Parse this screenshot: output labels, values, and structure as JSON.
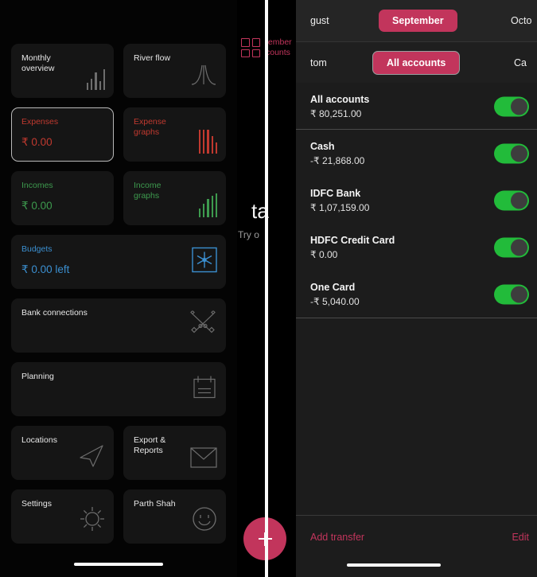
{
  "background": {
    "grid_icon": "grid-icon",
    "pink_text_line1": "tember",
    "pink_text_line2": "counts",
    "big_text": "ta",
    "sub_text": "Try o",
    "fab_icon": "plus-icon",
    "fab_color": "#c2355c"
  },
  "left_panel": {
    "cards": [
      {
        "title": "Monthly\noverview",
        "amount": "",
        "color": "#e8e8e8",
        "icon": "bar-chart-icon",
        "span": "half"
      },
      {
        "title": "River flow",
        "amount": "",
        "color": "#e8e8e8",
        "icon": "river-flow-icon",
        "span": "half"
      },
      {
        "title": "Expenses",
        "amount": "₹ 0.00",
        "color": "#c0392f",
        "icon": "",
        "span": "half",
        "selected": true
      },
      {
        "title": "Expense\ngraphs",
        "amount": "",
        "color": "#c0392f",
        "icon": "bar-chart-red-icon",
        "span": "half"
      },
      {
        "title": "Incomes",
        "amount": "₹ 0.00",
        "color": "#3d9a4e",
        "icon": "",
        "span": "half"
      },
      {
        "title": "Income\ngraphs",
        "amount": "",
        "color": "#3d9a4e",
        "icon": "bar-chart-green-icon",
        "span": "half"
      },
      {
        "title": "Budgets",
        "amount": "₹ 0.00 left",
        "color": "#3b8fd0",
        "icon": "budget-snowflake-icon",
        "span": "full"
      },
      {
        "title": "Bank connections",
        "amount": "",
        "color": "#e8e8e8",
        "icon": "crossed-keys-icon",
        "span": "full"
      },
      {
        "title": "Planning",
        "amount": "",
        "color": "#e8e8e8",
        "icon": "calendar-icon",
        "span": "full"
      },
      {
        "title": "Locations",
        "amount": "",
        "color": "#e8e8e8",
        "icon": "navigation-arrow-icon",
        "span": "half"
      },
      {
        "title": "Export &\nReports",
        "amount": "",
        "color": "#e8e8e8",
        "icon": "envelope-icon",
        "span": "half"
      },
      {
        "title": "Settings",
        "amount": "",
        "color": "#e8e8e8",
        "icon": "gear-sun-icon",
        "span": "half"
      },
      {
        "title": "Parth Shah",
        "amount": "",
        "color": "#e8e8e8",
        "icon": "smiley-face-icon",
        "span": "half"
      }
    ],
    "labels": {
      "monthly_overview": "Monthly\noverview",
      "river_flow": "River flow",
      "expenses": "Expenses",
      "expenses_amount": "₹ 0.00",
      "expense_graphs": "Expense\ngraphs",
      "incomes": "Incomes",
      "incomes_amount": "₹ 0.00",
      "income_graphs": "Income\ngraphs",
      "budgets": "Budgets",
      "budgets_amount": "₹ 0.00 left",
      "bank_connections": "Bank connections",
      "planning": "Planning",
      "locations": "Locations",
      "export_reports": "Export &\nReports",
      "settings": "Settings",
      "profile": "Parth Shah"
    }
  },
  "right_panel": {
    "month_segment": {
      "prev": "gust",
      "selected": "September",
      "next": "Octo"
    },
    "account_segment": {
      "prev": "tom",
      "selected": "All accounts",
      "next": "Ca"
    },
    "accounts": [
      {
        "name": "All accounts",
        "balance": "₹ 80,251.00",
        "enabled": true
      },
      {
        "name": "Cash",
        "balance": "-₹ 21,868.00",
        "enabled": true
      },
      {
        "name": "IDFC Bank",
        "balance": "₹ 1,07,159.00",
        "enabled": true
      },
      {
        "name": "HDFC Credit Card",
        "balance": "₹ 0.00",
        "enabled": true
      },
      {
        "name": "One Card",
        "balance": "-₹ 5,040.00",
        "enabled": true
      }
    ],
    "bottom_bar": {
      "add_transfer": "Add transfer",
      "edit": "Edit"
    }
  },
  "colors": {
    "accent_pink": "#c2355c",
    "toggle_green": "#22bb3a",
    "expense_red": "#c0392f",
    "income_green": "#3d9a4e",
    "budget_blue": "#3b8fd0",
    "panel_bg": "#1c1c1c",
    "card_bg": "#151515"
  }
}
